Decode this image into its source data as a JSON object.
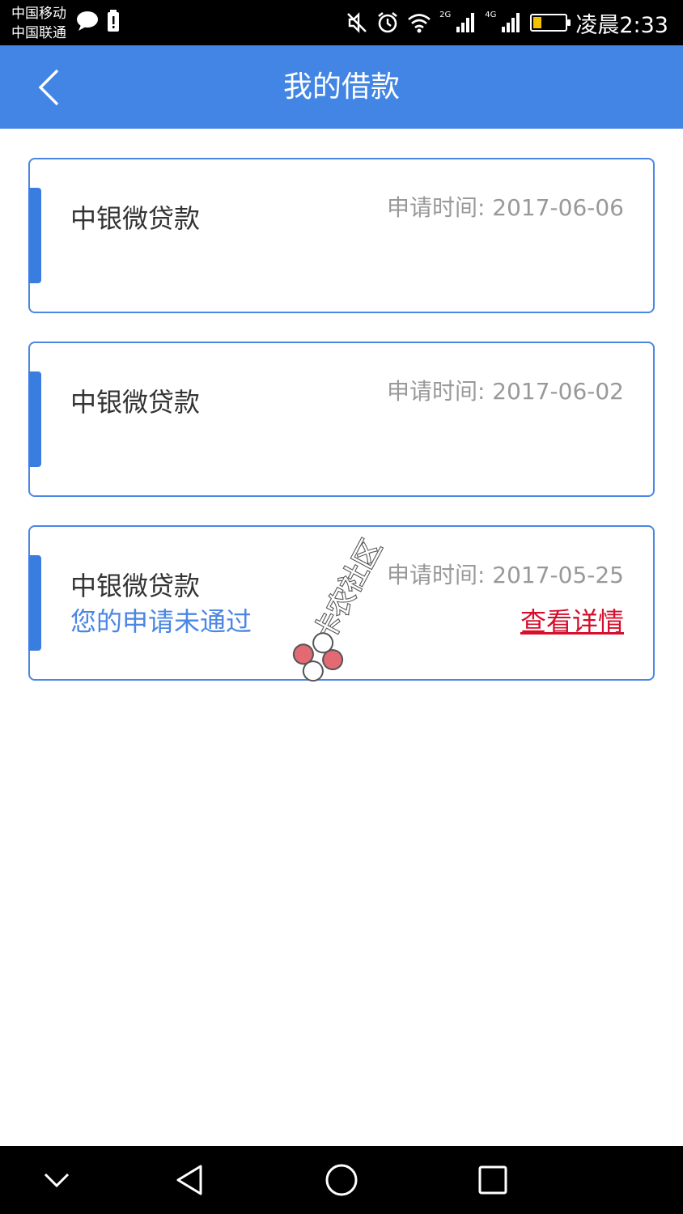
{
  "status_bar": {
    "carrier_1": "中国移动",
    "carrier_2": "中国联通",
    "network_2g": "2G",
    "network_4g": "4G",
    "time": "凌晨2:33",
    "battery_level": 0.25,
    "icons": [
      "chat-bubble-icon",
      "battery-alert-icon",
      "mute-icon",
      "alarm-icon",
      "wifi-icon",
      "signal-icon",
      "battery-icon"
    ]
  },
  "header": {
    "title": "我的借款",
    "back_icon": "chevron-left-icon"
  },
  "colors": {
    "primary": "#4285e4",
    "card_border": "#4a86e4",
    "accent": "#3a7de0",
    "link": "#d60f2c",
    "date_text": "#999999",
    "name_text": "#333333"
  },
  "loans": [
    {
      "name": "中银微贷款",
      "date_label": "申请时间: 2017-06-06",
      "status": "",
      "link": ""
    },
    {
      "name": "中银微贷款",
      "date_label": "申请时间: 2017-06-02",
      "status": "",
      "link": ""
    },
    {
      "name": "中银微贷款",
      "date_label": "申请时间: 2017-05-25",
      "status": "您的申请未通过",
      "link": "查看详情"
    }
  ],
  "watermark": {
    "text": "卡农社区"
  },
  "nav_bar": {
    "icons": [
      "chevron-down-icon",
      "back-triangle-icon",
      "home-circle-icon",
      "recents-square-icon"
    ]
  }
}
